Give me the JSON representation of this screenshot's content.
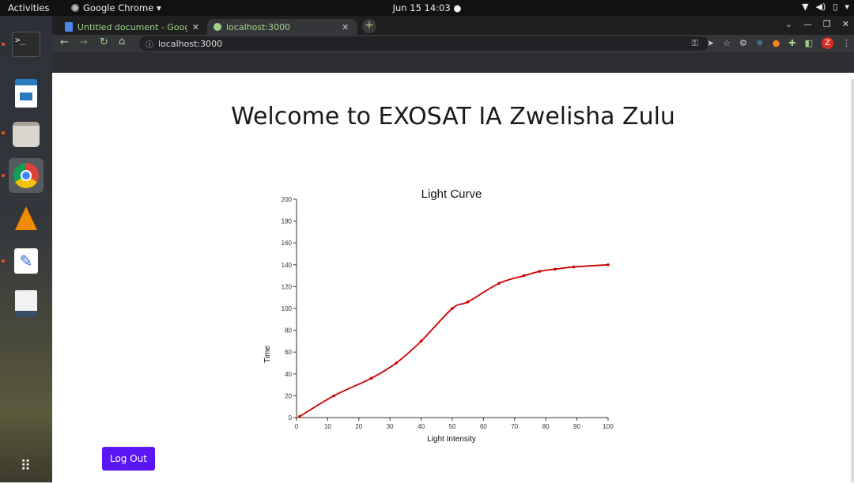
{
  "os": {
    "activities": "Activities",
    "app_menu": "Google Chrome ▾",
    "clock": "Jun 15 14:03 ●",
    "tray_icons": [
      "wifi-icon",
      "volume-icon",
      "battery-icon",
      "system-menu-icon"
    ],
    "dock": [
      "terminal",
      "libreoffice-impress",
      "files",
      "chrome",
      "vlc",
      "text-editor",
      "document-viewer",
      "app-grid"
    ]
  },
  "browser": {
    "tabs": [
      {
        "label": "Untitled document - Goog",
        "icon": "google-docs-icon",
        "active": false
      },
      {
        "label": "localhost:3000",
        "icon": "globe-icon",
        "active": true
      }
    ],
    "url": "localhost:3000",
    "profile_initial": "Z"
  },
  "page": {
    "title": "Welcome to EXOSAT IA Zwelisha Zulu",
    "logout_label": "Log Out"
  },
  "chart_data": {
    "type": "line",
    "title": "Light Curve",
    "xlabel": "Light Intensity",
    "ylabel": "Time",
    "xlim": [
      0,
      100
    ],
    "ylim": [
      0,
      200
    ],
    "x_ticks": [
      0,
      10,
      20,
      30,
      40,
      50,
      60,
      70,
      80,
      90,
      100
    ],
    "y_ticks": [
      0,
      20,
      40,
      60,
      80,
      100,
      120,
      140,
      160,
      180,
      200
    ],
    "series": [
      {
        "color": "#d00000",
        "x": [
          1,
          12,
          24,
          32,
          40,
          50,
          55,
          65,
          73,
          78,
          83,
          89,
          100
        ],
        "y": [
          1,
          20,
          36,
          50,
          70,
          100,
          106,
          123,
          130,
          134,
          136,
          138,
          140
        ]
      }
    ]
  }
}
